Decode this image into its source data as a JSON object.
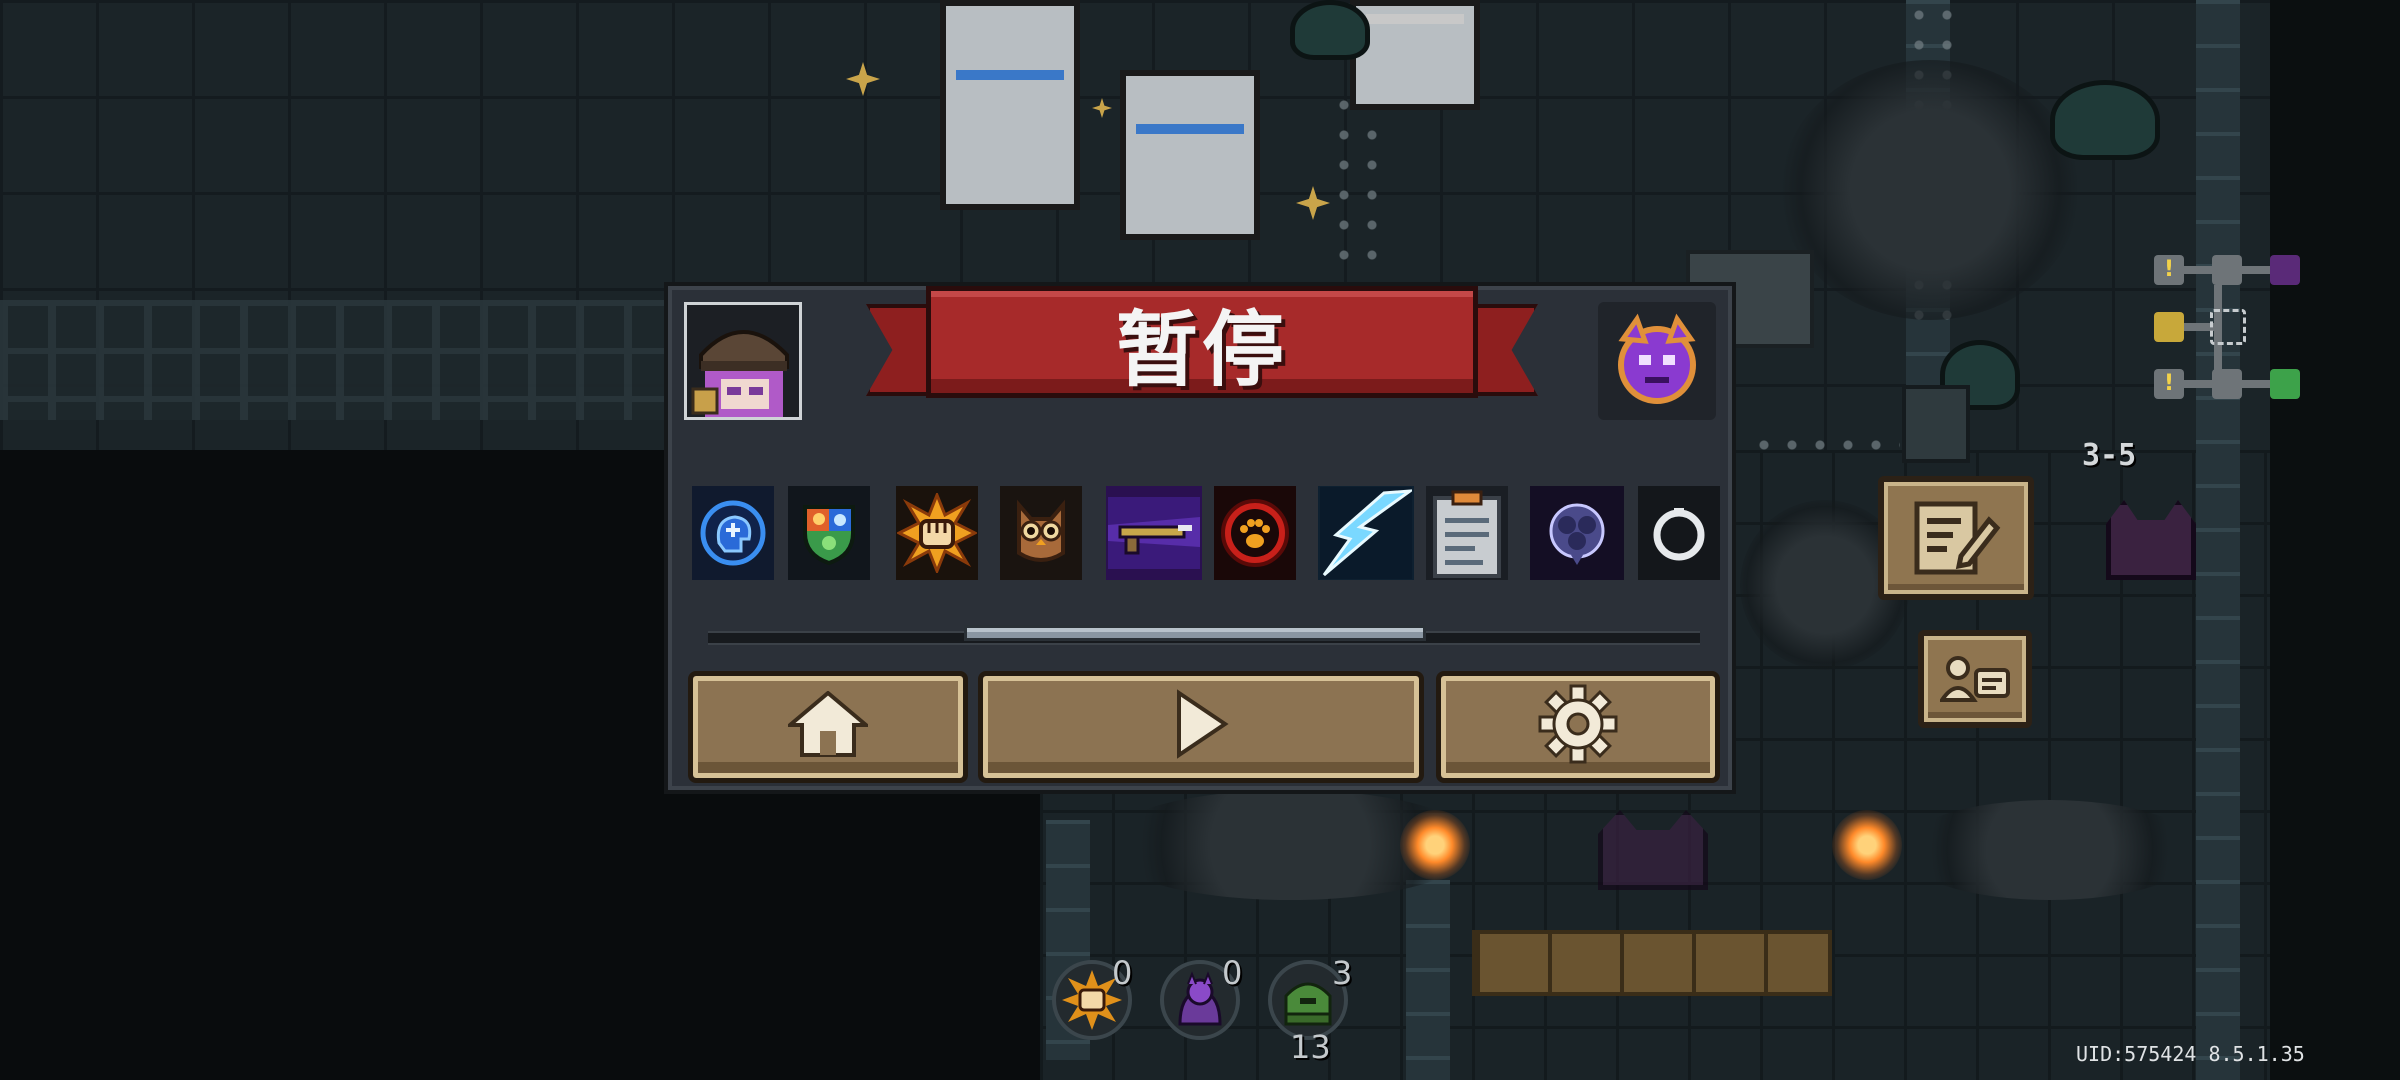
{
  "pause": {
    "title": "暂停",
    "buffs": [
      {
        "icon": "blue-brain-icon",
        "color": "#1d4fa8"
      },
      {
        "icon": "elemental-shield-icon",
        "color": "#3a8a4a"
      },
      {
        "icon": "exploding-fist-icon",
        "color": "#e08a1a"
      },
      {
        "icon": "owl-icon",
        "color": "#8a5a3a"
      },
      {
        "icon": "purple-gun-icon",
        "color": "#5a2a9a"
      },
      {
        "icon": "paw-print-icon",
        "color": "#c82a1a"
      },
      {
        "icon": "lightning-icon",
        "color": "#5ac8e8"
      },
      {
        "icon": "clipboard-icon",
        "color": "#8a9aa8"
      },
      {
        "icon": "dark-flower-icon",
        "color": "#4a4a8a"
      },
      {
        "icon": "ring-icon",
        "color": "#d0d4d8"
      }
    ],
    "buttons": [
      {
        "icon": "home-icon"
      },
      {
        "icon": "play-icon"
      },
      {
        "icon": "gear-icon"
      }
    ]
  },
  "hud": {
    "level": "3-5",
    "uid": "UID:575424 8.5.1.35",
    "currencies": [
      {
        "icon": "fist-coin-icon",
        "count": "0"
      },
      {
        "icon": "demon-coin-icon",
        "count": "0"
      },
      {
        "icon": "green-helmet-icon",
        "count": "3",
        "subcount": "13"
      }
    ]
  }
}
